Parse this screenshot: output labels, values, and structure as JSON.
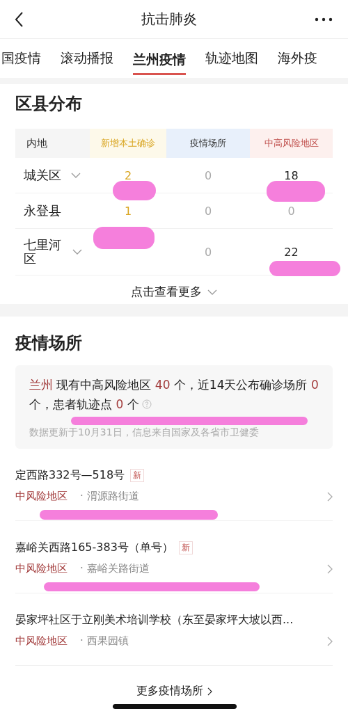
{
  "nav": {
    "title": "抗击肺炎"
  },
  "tabs": [
    {
      "label": "国疫情",
      "selected": false
    },
    {
      "label": "滚动播报",
      "selected": false
    },
    {
      "label": "兰州疫情",
      "selected": true
    },
    {
      "label": "轨迹地图",
      "selected": false
    },
    {
      "label": "海外疫",
      "selected": false
    }
  ],
  "district_section": {
    "title": "区县分布",
    "columns": [
      {
        "label": "内地",
        "kind": "region"
      },
      {
        "label": "新增本土确诊",
        "kind": "new"
      },
      {
        "label": "疫情场所",
        "kind": "venue"
      },
      {
        "label": "中高风险地区",
        "kind": "risk"
      }
    ],
    "rows": [
      {
        "name": "城关区",
        "expandable": true,
        "new_local": "2",
        "venues": "0",
        "risk_areas": "18"
      },
      {
        "name": "永登县",
        "expandable": false,
        "new_local": "1",
        "venues": "0",
        "risk_areas": "0"
      },
      {
        "name": "七里河区",
        "expandable": true,
        "venues": "0",
        "risk_areas": "22"
      }
    ],
    "more": "点击查看更多"
  },
  "venue_section": {
    "title": "疫情场所",
    "notice": [
      {
        "text": "兰州",
        "highlight": true
      },
      {
        "text": " 现有中高风险地区 ",
        "highlight": false
      },
      {
        "text": "40",
        "highlight": true
      },
      {
        "text": " 个，近14天公布确诊场所 ",
        "highlight": false
      },
      {
        "text": "0",
        "highlight": true
      },
      {
        "text": " 个，患者轨迹点 ",
        "highlight": false
      },
      {
        "text": "0",
        "highlight": true
      },
      {
        "text": " 个",
        "highlight": false
      }
    ],
    "update_note": "数据更新于10月31日，信息来自国家及各省市卫健委",
    "items": [
      {
        "title": "定西路332号—518号",
        "is_new": true,
        "badge": "新",
        "level": "中风险地区",
        "place": "· 渭源路街道"
      },
      {
        "title": "嘉峪关西路165-383号（单号）",
        "is_new": true,
        "badge": "新",
        "level": "中风险地区",
        "place": "· 嘉峪关路街道"
      },
      {
        "title": "晏家坪社区于立刚美术培训学校（东至晏家坪大坡以西...",
        "is_new": false,
        "level": "中风险地区",
        "place": "· 西果园镇"
      }
    ],
    "more_link": "更多疫情场所"
  }
}
